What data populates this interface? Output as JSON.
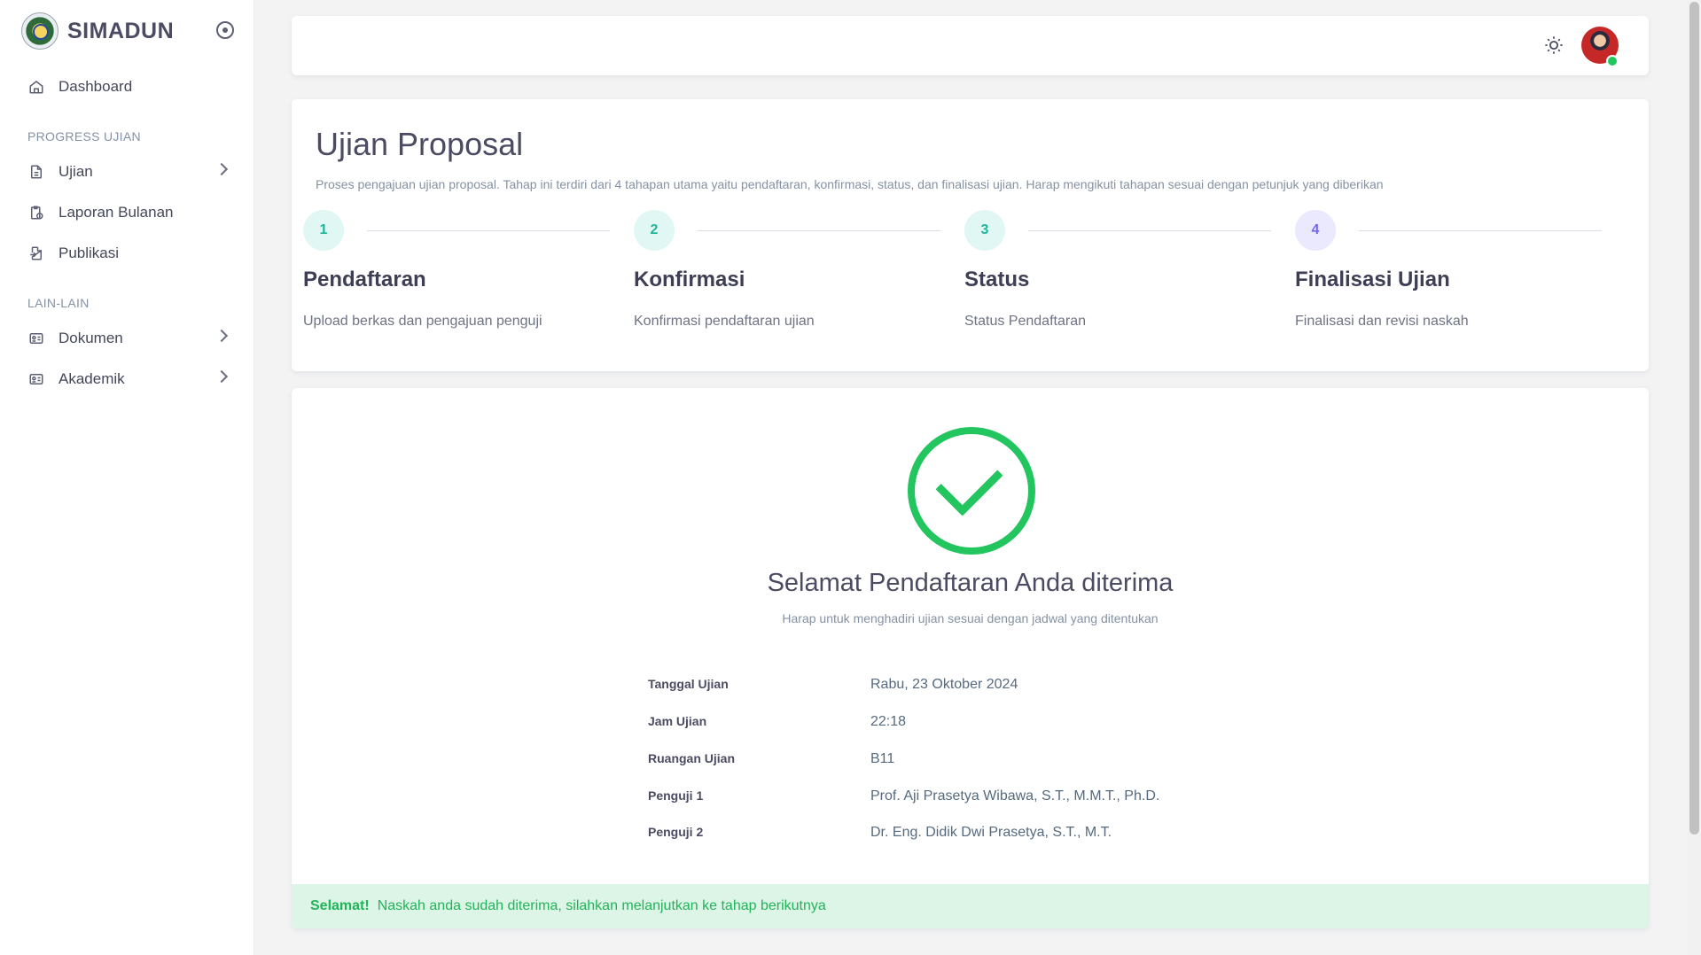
{
  "app": {
    "name": "SIMADUN"
  },
  "sidebar": {
    "items": [
      {
        "label": "Dashboard",
        "icon": "home-icon"
      },
      {
        "label": "Ujian",
        "icon": "file-icon"
      },
      {
        "label": "Laporan Bulanan",
        "icon": "clipboard-clock-icon"
      },
      {
        "label": "Publikasi",
        "icon": "file-upload-icon"
      },
      {
        "label": "Dokumen",
        "icon": "id-card-icon"
      },
      {
        "label": "Akademik",
        "icon": "id-card-icon"
      }
    ],
    "sections": {
      "progress": "PROGRESS UJIAN",
      "lain": "LAIN-LAIN"
    }
  },
  "header": {
    "theme_icon": "sun-icon",
    "avatar": "user-avatar"
  },
  "page": {
    "title": "Ujian Proposal",
    "description": "Proses pengajuan ujian proposal. Tahap ini terdiri dari 4 tahapan utama yaitu pendaftaran, konfirmasi, status, dan finalisasi ujian. Harap mengikuti tahapan sesuai dengan petunjuk yang diberikan"
  },
  "steps": [
    {
      "num": "1",
      "title": "Pendaftaran",
      "sub": "Upload berkas dan pengajuan penguji"
    },
    {
      "num": "2",
      "title": "Konfirmasi",
      "sub": "Konfirmasi pendaftaran ujian"
    },
    {
      "num": "3",
      "title": "Status",
      "sub": "Status Pendaftaran"
    },
    {
      "num": "4",
      "title": "Finalisasi Ujian",
      "sub": "Finalisasi dan revisi naskah"
    }
  ],
  "result": {
    "title": "Selamat Pendaftaran Anda diterima",
    "subtitle": "Harap untuk menghadiri ujian sesuai dengan jadwal yang ditentukan",
    "details": [
      {
        "label": "Tanggal Ujian",
        "value": "Rabu, 23 Oktober 2024"
      },
      {
        "label": "Jam Ujian",
        "value": "22:18"
      },
      {
        "label": "Ruangan Ujian",
        "value": "B11"
      },
      {
        "label": "Penguji 1",
        "value": "Prof. Aji Prasetya Wibawa, S.T., M.M.T., Ph.D."
      },
      {
        "label": "Penguji 2",
        "value": "Dr. Eng. Didik Dwi Prasetya, S.T., M.T."
      }
    ]
  },
  "alert": {
    "strong": "Selamat!",
    "text": "Naskah anda sudah diterima, silahkan melanjutkan ke tahap berikutnya"
  },
  "colors": {
    "success": "#22c55e",
    "step_teal_bg": "#e0f7f3",
    "step_teal_fg": "#1fb59a",
    "step_purple_bg": "#ebe9fd",
    "step_purple_fg": "#7367f0"
  }
}
